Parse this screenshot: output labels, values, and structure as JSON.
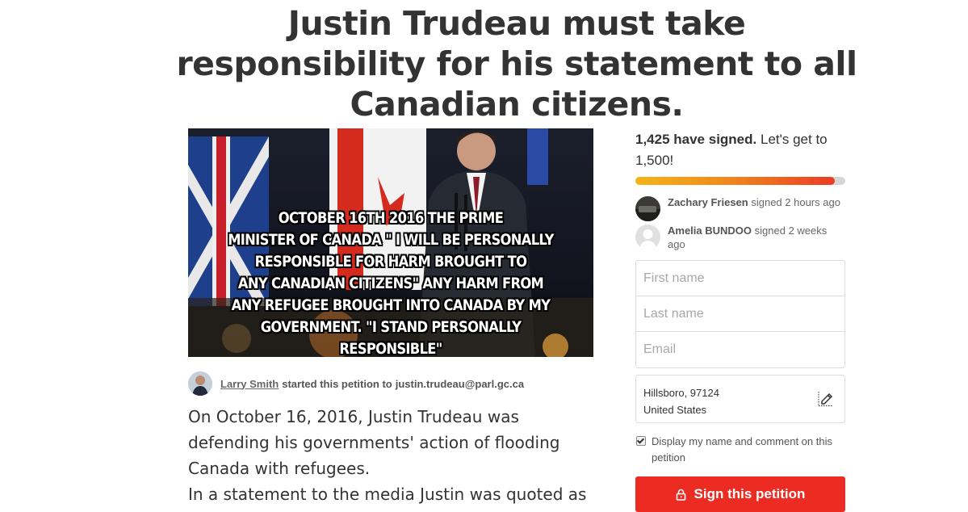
{
  "petition": {
    "title": "Justin Trudeau must take responsibility for his statement to all Canadian citizens.",
    "image_text": [
      "OCTOBER 16TH 2016 THE PRIME",
      "MINISTER OF CANADA \" I WILL BE PERSONALLY",
      "RESPONSIBLE FOR HARM BROUGHT TO",
      "ANY CANADIAN CITIZENS\" ANY HARM FROM",
      "ANY REFUGEE BROUGHT INTO CANADA BY MY",
      "GOVERNMENT. \"I STAND PERSONALLY RESPONSIBLE\""
    ],
    "starter_name": "Larry Smith",
    "starter_text": "started this petition to",
    "recipient": "justin.trudeau@parl.gc.ca",
    "body": [
      "On October 16, 2016, Justin Trudeau was defending his governments' action of flooding Canada with refugees.",
      "In a statement to the media Justin was quoted as"
    ]
  },
  "signatures": {
    "count_label": "1,425 have signed.",
    "goal_label": "Let's get to 1,500!",
    "signed": 1425,
    "goal": 1500,
    "progress_fraction": 0.95
  },
  "colors": {
    "progress_start": "#f6b417",
    "progress_end": "#ec3b23",
    "sign_button": "#ec2c22"
  },
  "recent_signers": [
    {
      "name": "Zachary Friesen",
      "when": "signed 2 hours ago"
    },
    {
      "name": "Amelia BUNDOO",
      "when": "signed 2 weeks ago"
    }
  ],
  "form": {
    "first_name_placeholder": "First name",
    "last_name_placeholder": "Last name",
    "email_placeholder": "Email",
    "location_line1": "Hillsboro, 97124",
    "location_line2": "United States",
    "consent_label": "Display my name and comment on this petition",
    "consent_checked": true,
    "sign_button_label": "Sign this petition"
  },
  "icons": {
    "edit": "edit-pencil-icon",
    "lock": "lock-icon",
    "checkbox": "checkmark-icon"
  }
}
